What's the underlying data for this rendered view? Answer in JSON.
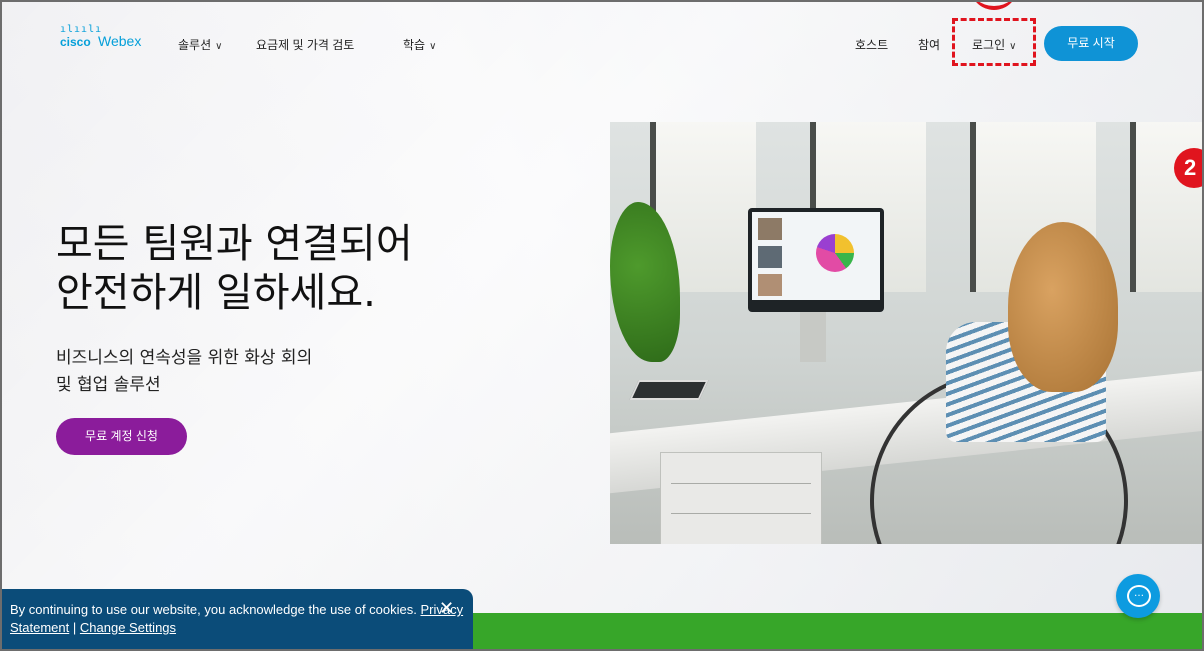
{
  "header": {
    "logo_bars": "ılıılı",
    "logo_cisco": "cisco",
    "logo_webex": "Webex",
    "nav": {
      "solutions": "솔루션",
      "pricing": "요금제 및 가격 검토",
      "learn": "학습",
      "host": "호스트",
      "join": "참여",
      "login": "로그인"
    },
    "start_free": "무료 시작"
  },
  "hero": {
    "title_line1": "모든 팀원과 연결되어",
    "title_line2": "안전하게 일하세요.",
    "subtitle_line1": "비즈니스의 연속성을 위한 화상 회의",
    "subtitle_line2": "및 협업 솔루션",
    "signup_button": "무료 계정 신청"
  },
  "annotation": {
    "number": "2"
  },
  "cookie_banner": {
    "text": "By continuing to use our website, you acknowledge the use of cookies.",
    "privacy_link": "Privacy Statement",
    "separator": "|",
    "settings_link": "Change Settings",
    "close_glyph": "✕"
  },
  "chat": {
    "glyph": "…"
  },
  "colors": {
    "brand_blue": "#0f93d6",
    "cta_purple": "#8b1c9b",
    "annotation_red": "#e0141e",
    "cookie_bg": "#0b4c79",
    "green_bar": "#37a629"
  },
  "icons": [
    "chevron-down-icon",
    "close-icon",
    "chat-icon"
  ]
}
